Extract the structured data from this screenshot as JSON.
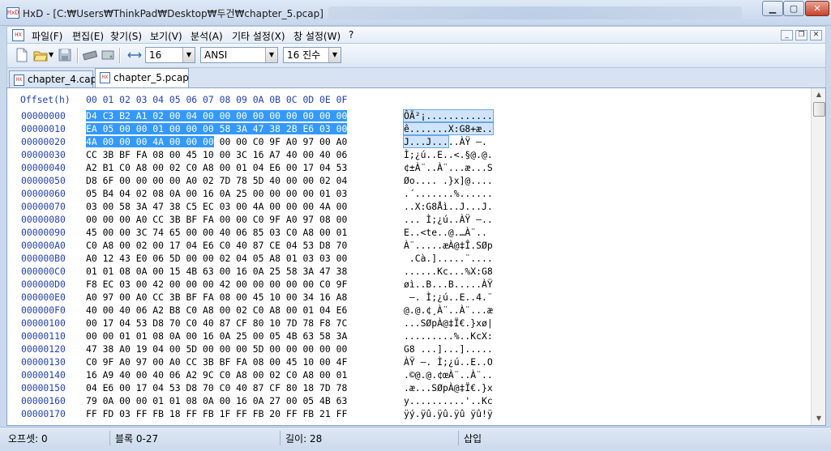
{
  "window": {
    "app_name": "HxD",
    "title": "HxD - [C:₩Users₩ThinkPad₩Desktop₩두건₩chapter_5.pcap]",
    "min_label": "▁",
    "max_label": "▢",
    "close_label": "✕"
  },
  "menu": {
    "items": [
      "파일(F)",
      "편집(E)",
      "찾기(S)",
      "보기(V)",
      "분석(A)",
      "기타 설정(X)",
      "창 설정(W)",
      "?"
    ],
    "mdi_min": "_",
    "mdi_restore": "❐",
    "mdi_close": "✕"
  },
  "toolbar": {
    "bytes_per_row": "16",
    "charset": "ANSI",
    "offset_base": "16 진수",
    "icons": [
      "new-file-icon",
      "open-file-icon",
      "save-icon",
      "ram-icon",
      "disk-icon",
      "columns-icon"
    ]
  },
  "tabs": [
    {
      "label": "chapter_4.cap",
      "active": false
    },
    {
      "label": "chapter_5.pcap",
      "active": true
    }
  ],
  "editor": {
    "header_offset": "Offset(h)",
    "header_columns": "00 01 02 03 04 05 06 07 08 09 0A 0B 0C 0D 0E 0F",
    "selection": {
      "start": 0,
      "length": 40
    },
    "rows": [
      {
        "off": "00000000",
        "hex": "D4 C3 B2 A1 02 00 04 00 00 00 00 00 00 00 00 00",
        "asc": "ÔÃ²¡............"
      },
      {
        "off": "00000010",
        "hex": "EA 05 00 00 01 00 00 00 58 3A 47 38 2B E6 03 00",
        "asc": "ê.......X:G8+æ.."
      },
      {
        "off": "00000020",
        "hex": "4A 00 00 00 4A 00 00 00 00 00 C0 9F A0 97 00 A0",
        "asc": "J...J.....ÀŸ —."
      },
      {
        "off": "00000030",
        "hex": "CC 3B BF FA 08 00 45 10 00 3C 16 A7 40 00 40 06",
        "asc": "Ì;¿ú..E..<.§@.@."
      },
      {
        "off": "00000040",
        "hex": "A2 B1 C0 A8 00 02 C0 A8 00 01 04 E6 00 17 04 53",
        "asc": "¢±À¨..À¨...æ...S"
      },
      {
        "off": "00000050",
        "hex": "D8 6F 00 00 00 00 A0 02 7D 78 5D 40 00 00 02 04",
        "asc": "Øo.... .}x]@...."
      },
      {
        "off": "00000060",
        "hex": "05 B4 04 02 08 0A 00 16 0A 25 00 00 00 00 01 03",
        "asc": ".´.......%......"
      },
      {
        "off": "00000070",
        "hex": "03 00 58 3A 47 38 C5 EC 03 00 4A 00 00 00 4A 00",
        "asc": "..X:G8Åì..J...J."
      },
      {
        "off": "00000080",
        "hex": "00 00 00 A0 CC 3B BF FA 00 00 C0 9F A0 97 08 00",
        "asc": "... Ì;¿ú..ÀŸ —.."
      },
      {
        "off": "00000090",
        "hex": "45 00 00 3C 74 65 00 00 40 06 85 03 C0 A8 00 01",
        "asc": "E..<te..@.…À¨.."
      },
      {
        "off": "000000A0",
        "hex": "C0 A8 00 02 00 17 04 E6 C0 40 87 CE 04 53 D8 70",
        "asc": "À¨.....æÀ@‡Î.SØp"
      },
      {
        "off": "000000B0",
        "hex": "A0 12 43 E0 06 5D 00 00 02 04 05 A8 01 03 03 00",
        "asc": " .Cà.].....¨...."
      },
      {
        "off": "000000C0",
        "hex": "01 01 08 0A 00 15 4B 63 00 16 0A 25 58 3A 47 38",
        "asc": "......Kc...%X:G8"
      },
      {
        "off": "000000D0",
        "hex": "F8 EC 03 00 42 00 00 00 42 00 00 00 00 00 C0 9F",
        "asc": "øì..B...B.....ÀŸ"
      },
      {
        "off": "000000E0",
        "hex": "A0 97 00 A0 CC 3B BF FA 08 00 45 10 00 34 16 A8",
        "asc": " —. Ì;¿ú..E..4.¨"
      },
      {
        "off": "000000F0",
        "hex": "40 00 40 06 A2 B8 C0 A8 00 02 C0 A8 00 01 04 E6",
        "asc": "@.@.¢¸À¨..À¨...æ"
      },
      {
        "off": "00000100",
        "hex": "00 17 04 53 D8 70 C0 40 87 CF 80 10 7D 78 F8 7C",
        "asc": "...SØpÀ@‡Ï€.}xø|"
      },
      {
        "off": "00000110",
        "hex": "00 00 01 01 08 0A 00 16 0A 25 00 05 4B 63 58 3A",
        "asc": ".........%..KcX:"
      },
      {
        "off": "00000120",
        "hex": "47 38 A0 19 04 00 5D 00 00 00 5D 00 00 00 00 00",
        "asc": "G8 ...]...]....."
      },
      {
        "off": "00000130",
        "hex": "C0 9F A0 97 00 A0 CC 3B BF FA 08 00 45 10 00 4F",
        "asc": "ÀŸ —. Ì;¿ú..E..O"
      },
      {
        "off": "00000140",
        "hex": "16 A9 40 00 40 06 A2 9C C0 A8 00 02 C0 A8 00 01",
        "asc": ".©@.@.¢œÀ¨..À¨.."
      },
      {
        "off": "00000150",
        "hex": "04 E6 00 17 04 53 D8 70 C0 40 87 CF 80 18 7D 78",
        "asc": ".æ...SØpÀ@‡Ï€.}x"
      },
      {
        "off": "00000160",
        "hex": "79 0A 00 00 01 01 08 0A 00 16 0A 27 00 05 4B 63",
        "asc": "y..........'..Kc"
      },
      {
        "off": "00000170",
        "hex": "FF FD 03 FF FB 18 FF FB 1F FF FB 20 FF FB 21 FF",
        "asc": "ÿý.ÿû.ÿû.ÿû ÿû!ÿ"
      }
    ]
  },
  "status": {
    "offset": "오프셋: 0",
    "block": "블록 0-27",
    "length": "길이: 28",
    "mode": "삽입"
  }
}
